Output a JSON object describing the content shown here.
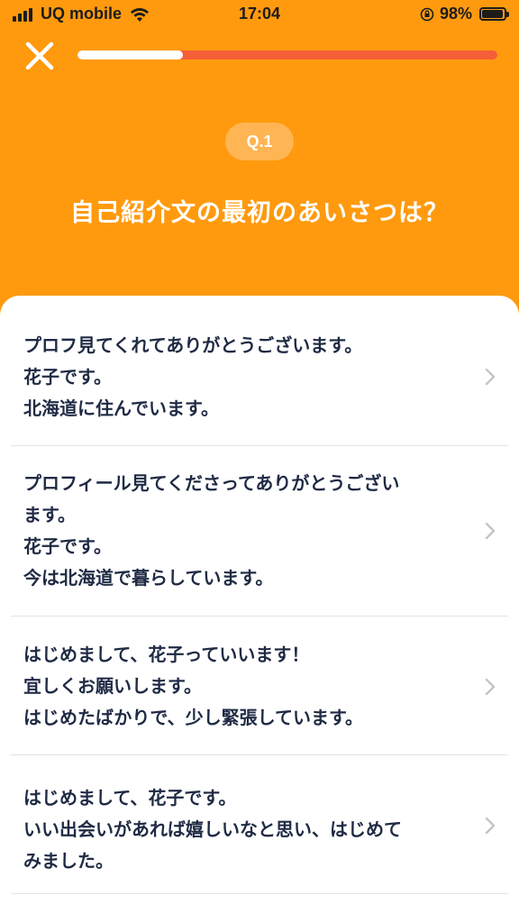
{
  "status_bar": {
    "carrier": "UQ mobile",
    "time": "17:04",
    "battery_percent": "98%"
  },
  "header": {
    "progress": 0.25,
    "question_number": "Q.1",
    "question_text": "自己紹介文の最初のあいさつは？"
  },
  "options": [
    {
      "text": "プロフ見てくれてありがとうございます。\n花子です。\n北海道に住んでいます。"
    },
    {
      "text": "プロフィール見てくださってありがとうござい\nます。\n花子です。\n今は北海道で暮らしています。"
    },
    {
      "text": "はじめまして、花子っていいます！\n宜しくお願いします。\nはじめたばかりで、少し緊張しています。"
    },
    {
      "text": "はじめまして、花子です。\nいい出会いがあれば嬉しいなと思い、はじめて\nみました。"
    }
  ],
  "colors": {
    "brand_orange": "#ff9a0e",
    "progress_track": "#f45f38",
    "badge_bg": "#ffb553",
    "option_text": "#1f2a44"
  },
  "icons": [
    "signal-icon",
    "wifi-icon",
    "rotation-lock-icon",
    "battery-icon",
    "close-icon",
    "chevron-right-icon"
  ]
}
